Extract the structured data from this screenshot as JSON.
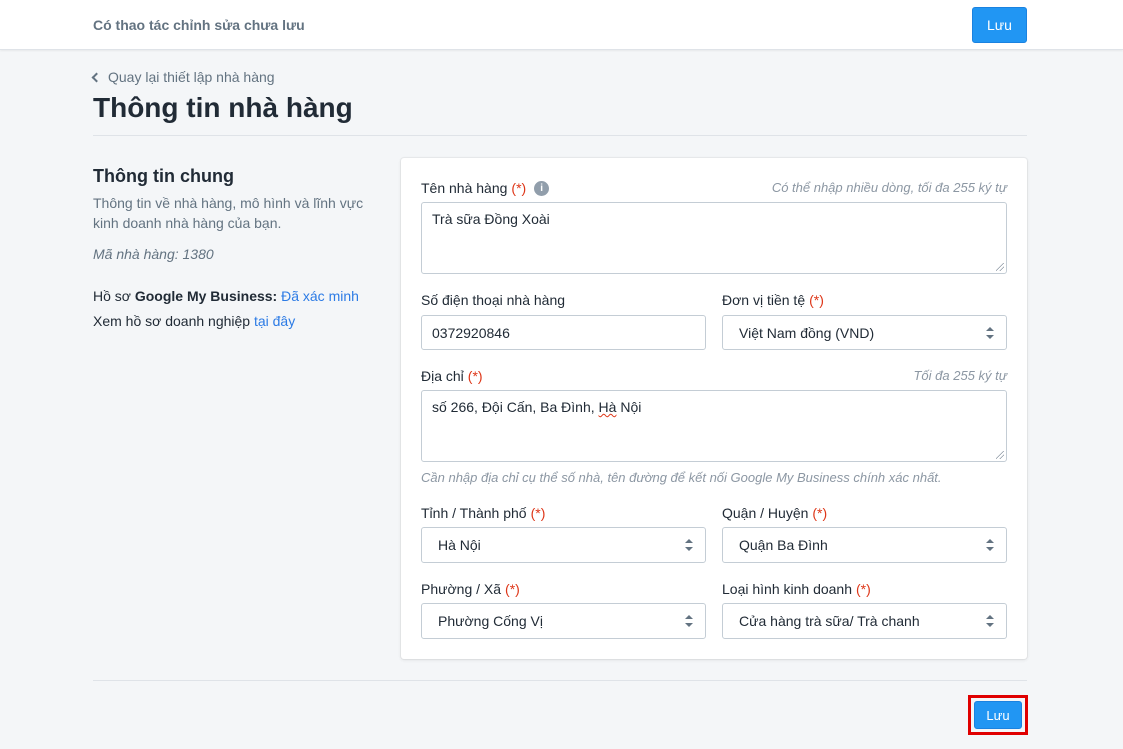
{
  "topbar": {
    "message": "Có thao tác chỉnh sửa chưa lưu",
    "save_label": "Lưu"
  },
  "breadcrumb": {
    "back_label": "Quay lại thiết lập nhà hàng"
  },
  "page": {
    "title": "Thông tin nhà hàng"
  },
  "sidebar": {
    "title": "Thông tin chung",
    "description": "Thông tin về nhà hàng, mô hình và lĩnh vực kinh doanh nhà hàng của bạn.",
    "code_label": "Mã nhà hàng:",
    "code_value": "1380",
    "gmb_prefix": "Hồ sơ",
    "gmb_bold": "Google My Business:",
    "gmb_status": "Đã xác minh",
    "view_prefix": "Xem hồ sơ doanh nghiệp",
    "view_link": "tại đây"
  },
  "form": {
    "required_mark": "(*)",
    "name": {
      "label": "Tên nhà hàng",
      "hint": "Có thể nhập nhiều dòng, tối đa 255 ký tự",
      "value": "Trà sữa Đồng Xoài",
      "info_icon": "i"
    },
    "phone": {
      "label": "Số điện thoại nhà hàng",
      "value": "0372920846"
    },
    "currency": {
      "label": "Đơn vị tiền tệ",
      "value": "Việt Nam đồng (VND)"
    },
    "address": {
      "label": "Địa chỉ",
      "hint": "Tối đa 255 ký tự",
      "value_main": "số 266, Đội Cấn, Ba Đình, ",
      "value_tail": "Hà",
      "value_end": " Nội",
      "help": "Cần nhập địa chỉ cụ thể số nhà, tên đường để kết nối Google My Business chính xác nhất."
    },
    "city": {
      "label": "Tỉnh / Thành phố",
      "value": "Hà Nội"
    },
    "district": {
      "label": "Quận / Huyện",
      "value": "Quận Ba Đình"
    },
    "ward": {
      "label": "Phường / Xã",
      "value": "Phường Cống Vị"
    },
    "business_type": {
      "label": "Loại hình kinh doanh",
      "value": "Cửa hàng trà sữa/ Trà chanh"
    }
  },
  "footer": {
    "save_label": "Lưu"
  },
  "colors": {
    "primary": "#2196f3",
    "required": "#de3618",
    "link": "#2c7be5",
    "highlight_box": "#e00000"
  }
}
